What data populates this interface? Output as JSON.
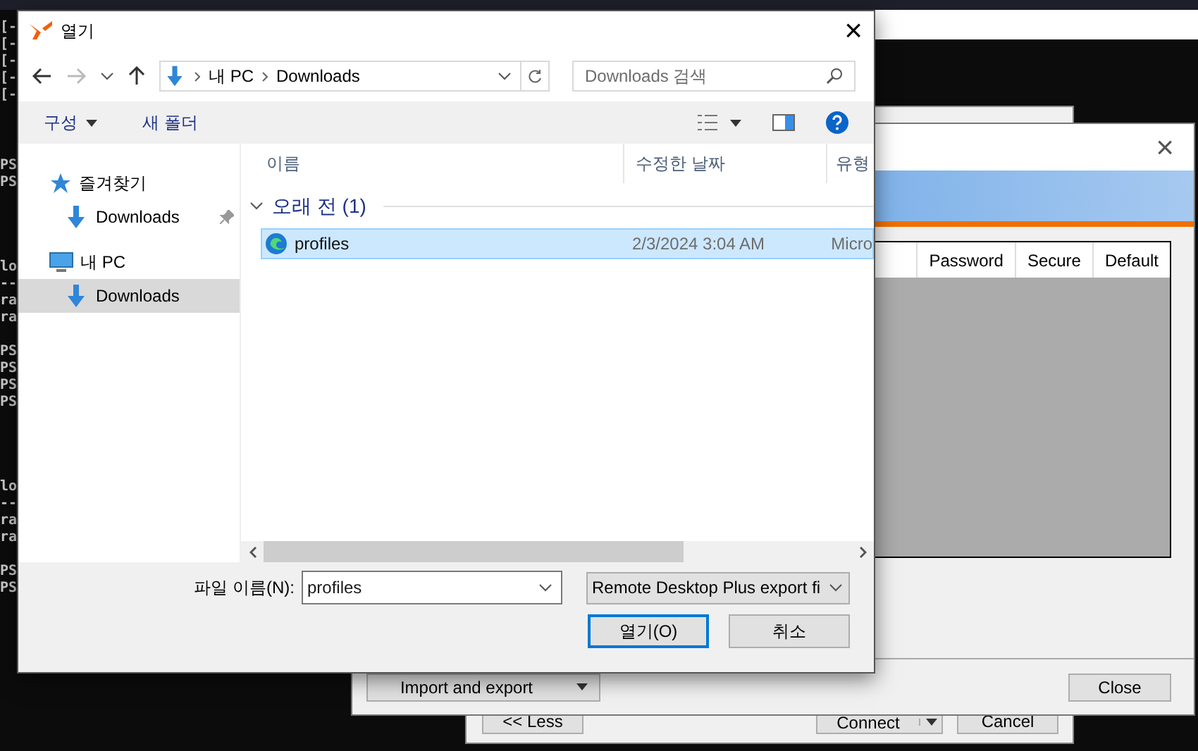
{
  "terminal": {
    "blocks": [
      [
        "[-",
        "[-",
        "[-",
        "[-",
        "[-"
      ],
      [
        "PS",
        "PS"
      ],
      [
        "lo",
        "--",
        "ra",
        "ra"
      ],
      [
        "PS",
        "PS",
        "PS",
        "PS"
      ],
      [
        "lo",
        "--",
        "ra",
        "ra"
      ],
      [
        "PS",
        "PS"
      ]
    ]
  },
  "back_window": {
    "buttons": [
      {
        "label": "<< Less",
        "kind": "plain"
      },
      {
        "label": "Connect",
        "kind": "split"
      },
      {
        "label": "Cancel",
        "kind": "plain"
      }
    ]
  },
  "manager_window": {
    "close_glyph": "×",
    "columns": [
      "Password",
      "Secure",
      "Default"
    ],
    "footer": {
      "split_button": "Import and export",
      "close_button": "Close"
    }
  },
  "dialog": {
    "title": "열기",
    "close_glyph": "×",
    "address": {
      "path": [
        "내 PC",
        "Downloads"
      ],
      "search_placeholder": "Downloads 검색"
    },
    "toolbar": {
      "organize": "구성",
      "new_folder": "새 폴더"
    },
    "nav": [
      {
        "label": "즐겨찾기",
        "kind": "favorites",
        "selected": false,
        "pinned": false,
        "children": [
          {
            "label": "Downloads",
            "kind": "folder",
            "selected": false,
            "pinned": true
          }
        ]
      },
      {
        "label": "내 PC",
        "kind": "computer",
        "selected": false,
        "pinned": false,
        "children": [
          {
            "label": "Downloads",
            "kind": "folder",
            "selected": true,
            "pinned": false
          }
        ]
      }
    ],
    "columns": [
      "이름",
      "수정한 날짜",
      "유형"
    ],
    "group": {
      "label": "오래 전 (1)",
      "expanded": true
    },
    "files": [
      {
        "name": "profiles",
        "modified": "2/3/2024 3:04 AM",
        "type": "Micro",
        "selected": true
      }
    ],
    "filename_label": "파일 이름(N):",
    "filename_value": "profiles",
    "filetype": "Remote Desktop Plus export fi",
    "buttons": [
      {
        "label": "열기(O)",
        "default": true
      },
      {
        "label": "취소",
        "default": false
      }
    ]
  }
}
